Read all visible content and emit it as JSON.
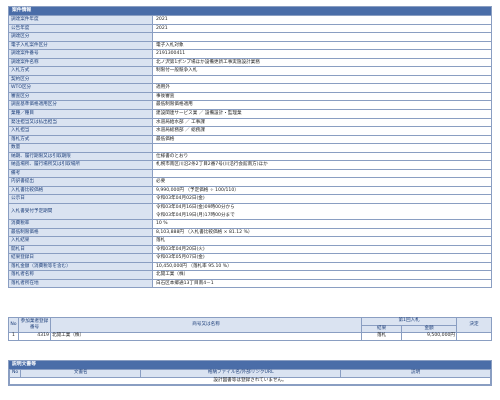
{
  "case": {
    "header": "案件情報",
    "rows": [
      {
        "label": "調達案件年度",
        "value": "2021"
      },
      {
        "label": "公告年度",
        "value": "2021"
      },
      {
        "label": "調達区分",
        "value": ""
      },
      {
        "label": "電子入札案件区分",
        "value": "電子入札対象"
      },
      {
        "label": "調達案件番号",
        "value": "2191300411"
      },
      {
        "label": "調達案件名称",
        "value": "北ノ沢第1ポンプ場ほか設備更新工事実施設計業務"
      },
      {
        "label": "入札方式",
        "value": "制限付一般競争入札"
      },
      {
        "label": "契約区分",
        "value": ""
      },
      {
        "label": "WTO区分",
        "value": "適用外"
      },
      {
        "label": "審査区分",
        "value": "事後審査"
      },
      {
        "label": "調査基準価格適用区分",
        "value": "最低制限価格適用"
      },
      {
        "label": "業種／種目",
        "value": "建設関連サービス業 ／ 設備設計・監理業"
      },
      {
        "label": "発注担当又は払出担当",
        "value": "水道局給水部 ／ 工事課"
      },
      {
        "label": "入札担当",
        "value": "水道局総務部 ／ 総務課"
      },
      {
        "label": "落札方式",
        "value": "最低価格"
      },
      {
        "label": "数量",
        "value": ""
      },
      {
        "label": "納期、履行期限又は引取期限",
        "value": "仕様書のとおり"
      },
      {
        "label": "納品場所、履行場所又は引取場所",
        "value": "札幌市南区川沿2条2丁目2番7号(川沿行会館南方)ほか"
      },
      {
        "label": "備考",
        "value": ""
      },
      {
        "label": "内訳書提出",
        "value": "必要"
      },
      {
        "label": "入札書比較価格",
        "value": "9,990,000円 （予定価格 ÷ 100/110）"
      },
      {
        "label": "公示日",
        "value": "令和03年04月02日(金)"
      },
      {
        "label": "入札書受付予定期間",
        "value": "令和03年04月16日(金)09時00分から",
        "value2": "令和03年04月19日(月)17時00分まで"
      },
      {
        "label": "消費税率",
        "value": "10 %"
      },
      {
        "label": "最低制限価格",
        "value": "8,103,888円 （入札書比較価格 × 81.12 %）"
      },
      {
        "label": "入札結果",
        "value": "落札"
      },
      {
        "label": "開札日",
        "value": "令和03年04月20日(火)"
      },
      {
        "label": "結果登録日",
        "value": "令和03年05月07日(金)"
      },
      {
        "label": "落札金額（消費税等を含む）",
        "value": "10,450,000円 （落札率 95.10 %）"
      },
      {
        "label": "落札者名称",
        "value": "北開工業（株）"
      },
      {
        "label": "落札者所在地",
        "value": "白石区本郷通13丁目南4－1"
      }
    ]
  },
  "bid_table": {
    "col_no": "No",
    "col_reg": "参加業者登録番号",
    "col_name": "商号又は名称",
    "col_round": "第1回入札",
    "col_result": "結果",
    "col_amount": "金額",
    "col_decision": "決定",
    "rows": [
      {
        "no": "1",
        "reg": "4319",
        "name": "北開工業（株）",
        "result": "落札",
        "amount": "9,500,000円",
        "decision": ""
      }
    ]
  },
  "docs": {
    "header": "説明文書等",
    "col_no": "No",
    "col_name": "文書名",
    "col_link": "格納ファイル名/外部リンクURL",
    "col_desc": "説明",
    "empty": "設計図書等は登録されていません。"
  }
}
